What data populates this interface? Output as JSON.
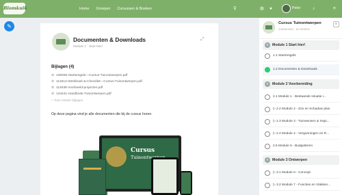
{
  "header": {
    "logo_text": "Blomkuik",
    "nav": [
      "Home",
      "Groepen",
      "Cursussen & Boeken"
    ],
    "user_name": "Peter",
    "icons": [
      "search-icon",
      "globe-icon",
      "chat-icon",
      "bell-icon",
      "menu-icon"
    ]
  },
  "content": {
    "title": "Documenten & Downloads",
    "subtitle": "Module 1 · Start hier!",
    "attachments_heading": "Bijlagen (4)",
    "attachments": [
      "105006-Startersgids---Cursus-Tuinontwerpen.pdf",
      "114614-Werkboek-&-Checklist---Cursus-Tuinontwerpen.pdf",
      "114638-Voorbeeld-projecten.pdf",
      "134441-Handboek-Tuinontwerpen.pdf"
    ],
    "toggle_less": "Toon minder bijlagen",
    "description": "Op deze pagina vind je alle documenten die bij de cursus horen.",
    "product_title_line1": "Cursus",
    "product_title_line2": "Tuinontwerpen"
  },
  "sidebar": {
    "course_title": "Cursus Tuinontwerpen",
    "course_meta": "3 MODULES · 18 LESSEN",
    "modules": [
      {
        "label": "Module 1   Start hier!",
        "lessons": [
          {
            "label": "1.1 Startersgids",
            "done": false
          },
          {
            "label": "1.2 Documenten & Downloads",
            "done": true,
            "active": true
          }
        ]
      },
      {
        "label": "Module 2   Voorbereiding",
        "lessons": [
          {
            "label": "2.1 Module 1 - Bestaande situatie i...",
            "done": false
          },
          {
            "label": "▷ 2.2 Module 2 - Zon en Schaduw plan",
            "done": false
          },
          {
            "label": "▷ 2.3 Module 3 - Tuinwensen & Inspi...",
            "done": false
          },
          {
            "label": "▷ 2.4 Module 4 - Vergunningen en R...",
            "done": false
          },
          {
            "label": "2.5 Module 5 - Budgetteren",
            "done": false
          }
        ]
      },
      {
        "label": "Module 3   Ontwerpen",
        "lessons": [
          {
            "label": "▷ 3.1 Module 6 - Concept",
            "done": false
          },
          {
            "label": "▷ 3.2 Module 7 - Functies en Vlakken...",
            "done": false
          }
        ]
      }
    ]
  }
}
